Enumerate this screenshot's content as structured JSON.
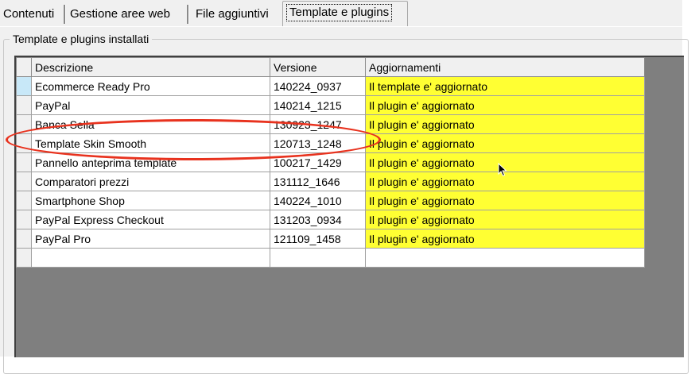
{
  "tabs": [
    {
      "label": "Contenuti",
      "active": false
    },
    {
      "label": "Gestione aree web",
      "active": false
    },
    {
      "label": "File aggiuntivi",
      "active": false
    },
    {
      "label": "Template e plugins",
      "active": true
    }
  ],
  "group_title": "Template e plugins installati",
  "table": {
    "columns": [
      "Descrizione",
      "Versione",
      "Aggiornamenti"
    ],
    "rows": [
      {
        "descrizione": "Ecommerce Ready Pro",
        "versione": "140224_0937",
        "aggiornamenti": "Il template e' aggiornato"
      },
      {
        "descrizione": "PayPal",
        "versione": "140214_1215",
        "aggiornamenti": "Il plugin e' aggiornato"
      },
      {
        "descrizione": "Banca Sella",
        "versione": "130923_1247",
        "aggiornamenti": "Il plugin e' aggiornato"
      },
      {
        "descrizione": "Template Skin Smooth",
        "versione": "120713_1248",
        "aggiornamenti": "Il plugin e' aggiornato"
      },
      {
        "descrizione": "Pannello anteprima template",
        "versione": "100217_1429",
        "aggiornamenti": "Il plugin e' aggiornato"
      },
      {
        "descrizione": "Comparatori prezzi",
        "versione": "131112_1646",
        "aggiornamenti": "Il plugin e' aggiornato"
      },
      {
        "descrizione": "Smartphone Shop",
        "versione": "140224_1010",
        "aggiornamenti": "Il plugin e' aggiornato"
      },
      {
        "descrizione": "PayPal Express Checkout",
        "versione": "131203_0934",
        "aggiornamenti": "Il plugin e' aggiornato"
      },
      {
        "descrizione": "PayPal Pro",
        "versione": "121109_1458",
        "aggiornamenti": "Il plugin e' aggiornato"
      }
    ]
  },
  "colors": {
    "update_status_bg": "#ffff33",
    "highlight_ring": "#e8321e",
    "grid_background": "#7f7f7f",
    "current_row_indicator": "#c8e8f8"
  }
}
